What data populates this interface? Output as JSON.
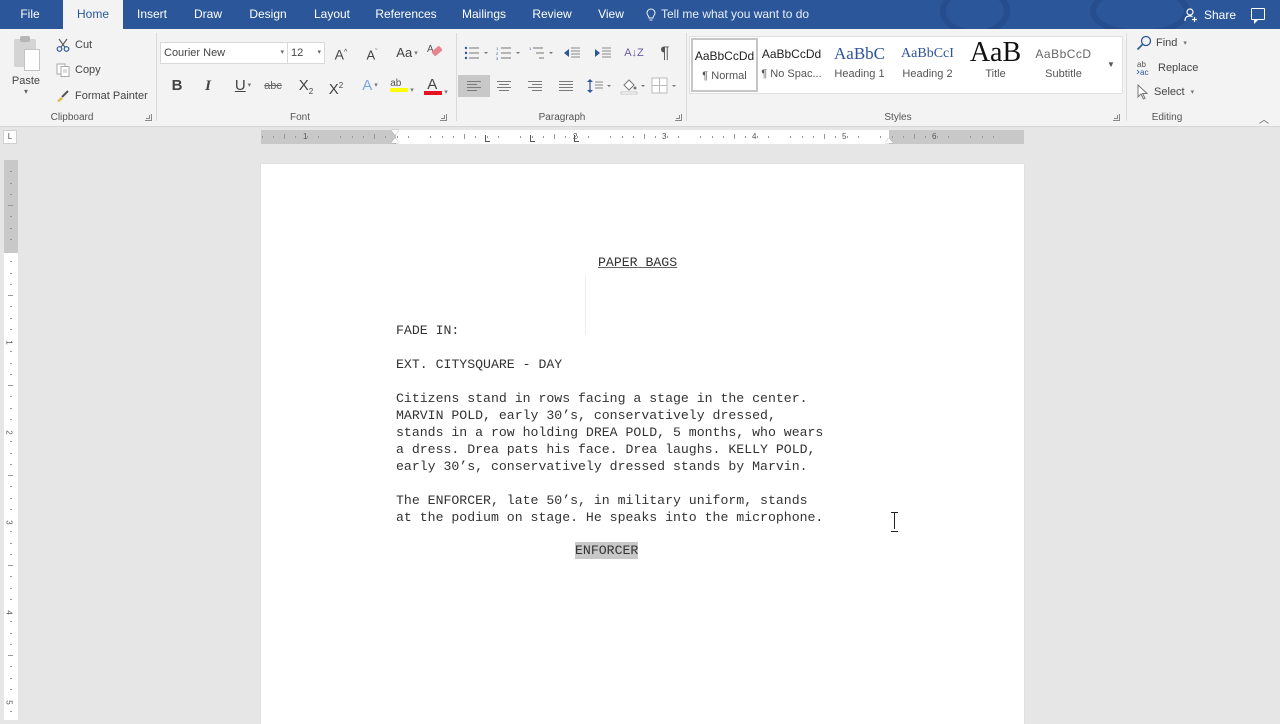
{
  "app": {
    "name": "Microsoft Word"
  },
  "colors": {
    "brand": "#2b579a",
    "ribbon_bg": "#f3f3f3",
    "highlight": "#ffff00",
    "font_color": "#e81123",
    "selection": "#c8c8c8"
  },
  "tabs": [
    {
      "label": "File",
      "active": false
    },
    {
      "label": "Home",
      "active": true
    },
    {
      "label": "Insert",
      "active": false
    },
    {
      "label": "Draw",
      "active": false
    },
    {
      "label": "Design",
      "active": false
    },
    {
      "label": "Layout",
      "active": false
    },
    {
      "label": "References",
      "active": false
    },
    {
      "label": "Mailings",
      "active": false
    },
    {
      "label": "Review",
      "active": false
    },
    {
      "label": "View",
      "active": false
    }
  ],
  "tell_me": {
    "placeholder": "Tell me what you want to do",
    "icon": "lightbulb-icon"
  },
  "share": {
    "label": "Share",
    "icon": "person-add-icon"
  },
  "comments": {
    "icon": "comment-icon"
  },
  "clipboard": {
    "group_label": "Clipboard",
    "paste": "Paste",
    "cut": "Cut",
    "copy": "Copy",
    "format_painter": "Format Painter"
  },
  "font": {
    "group_label": "Font",
    "family": "Courier New",
    "size": "12",
    "grow": "A",
    "shrink": "A",
    "change_case": "Aa",
    "bold": "B",
    "italic": "I",
    "underline": "U",
    "strikethrough": "abc",
    "subscript": "X",
    "subscript_sub": "2",
    "superscript": "X",
    "superscript_sup": "2",
    "text_effects": "A",
    "highlight": "ab",
    "font_color": "A"
  },
  "paragraph": {
    "group_label": "Paragraph",
    "sort": "A↓Z",
    "show_marks": "¶",
    "alignment_selected": "left"
  },
  "styles": {
    "group_label": "Styles",
    "items": [
      {
        "sample": "AaBbCcDd",
        "name": "¶ Normal",
        "selected": true
      },
      {
        "sample": "AaBbCcDd",
        "name": "¶ No Spac...",
        "selected": false
      },
      {
        "sample": "AaBbC",
        "name": "Heading 1",
        "selected": false
      },
      {
        "sample": "AaBbCcI",
        "name": "Heading 2",
        "selected": false
      },
      {
        "sample": "AaB",
        "name": "Title",
        "selected": false
      },
      {
        "sample": "AaBbCcD",
        "name": "Subtitle",
        "selected": false
      }
    ]
  },
  "editing": {
    "group_label": "Editing",
    "find": "Find",
    "replace": "Replace",
    "select": "Select"
  },
  "ruler": {
    "h_numbers": [
      "1",
      "1",
      "2",
      "3",
      "4",
      "5",
      "6"
    ],
    "v_numbers": [
      "1",
      "1",
      "2",
      "3",
      "4",
      "5"
    ],
    "corner": "L"
  },
  "document": {
    "title": "PAPER BAGS",
    "lines": [
      "FADE IN:",
      "EXT. CITYSQUARE - DAY",
      "Citizens stand in rows facing a stage in the center.",
      "MARVIN POLD, early 30’s, conservatively dressed,",
      "stands in a row holding DREA POLD, 5 months, who wears",
      "a dress. Drea pats his face. Drea laughs. KELLY POLD,",
      "early 30’s, conservatively dressed stands by Marvin.",
      "The ENFORCER, late 50’s, in military uniform, stands",
      "at the podium on stage. He speaks into the microphone."
    ],
    "character": "ENFORCER"
  }
}
